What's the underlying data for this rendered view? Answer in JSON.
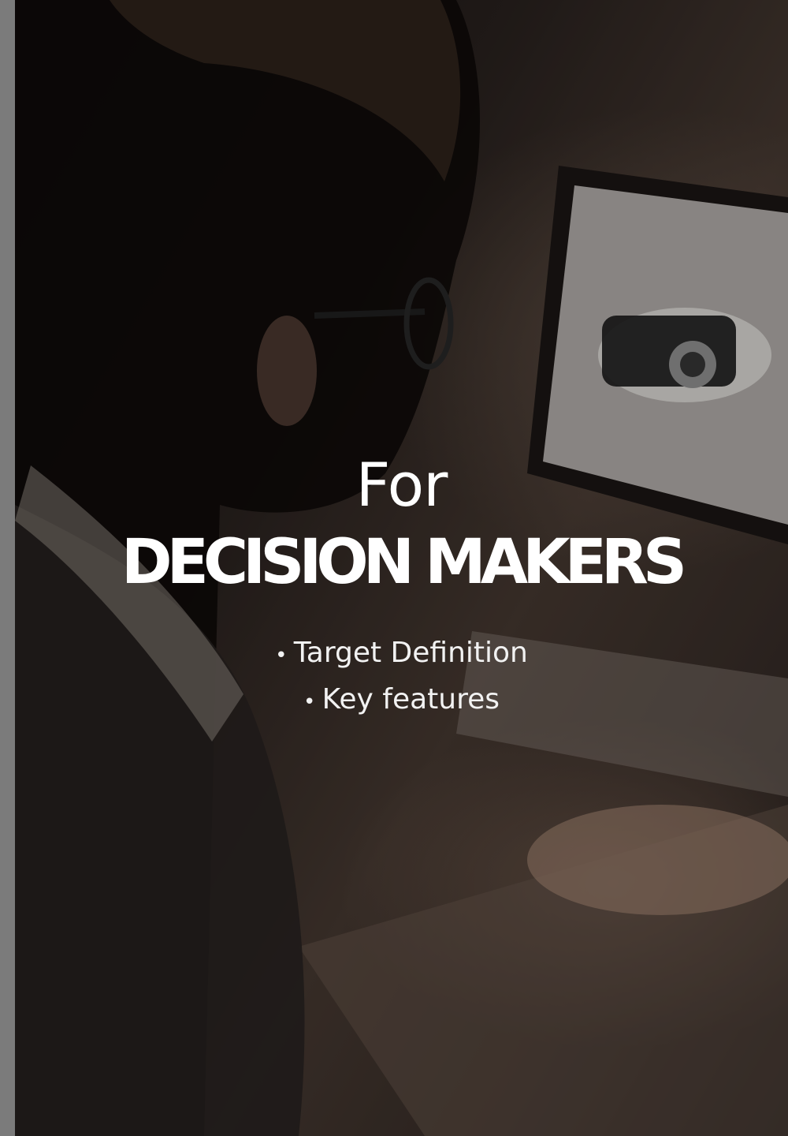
{
  "cover": {
    "for_label": "For",
    "title": "DECISION MAKERS",
    "bullets": [
      "Target Definition",
      "Key features"
    ]
  },
  "colors": {
    "text": "#ffffff",
    "edge": "#7b7b7b",
    "background": "#2a2320"
  }
}
